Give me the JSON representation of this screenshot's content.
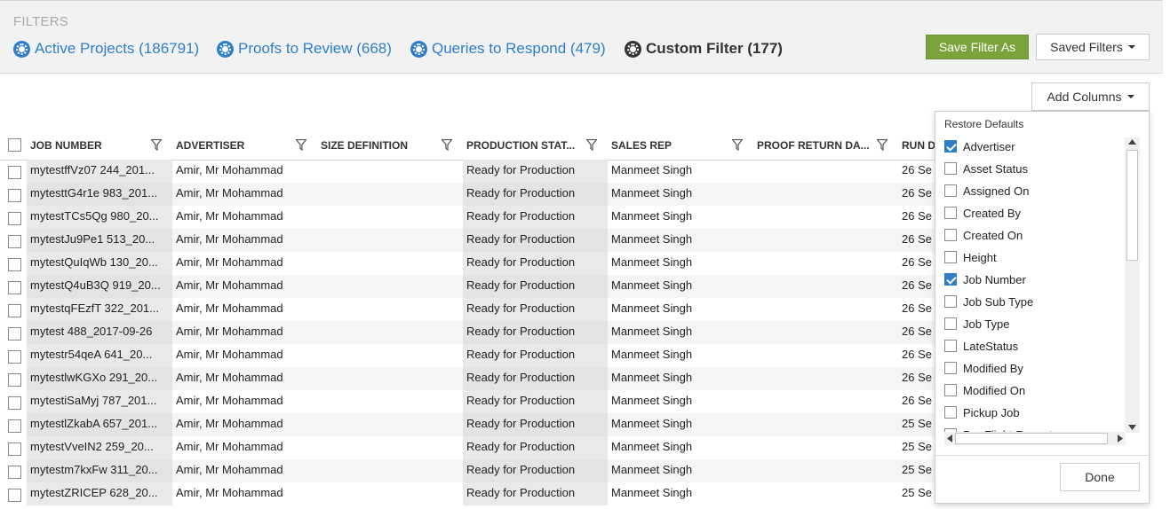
{
  "filters": {
    "title": "FILTERS",
    "links": [
      {
        "label": "Active Projects (186791)"
      },
      {
        "label": "Proofs to Review (668)"
      },
      {
        "label": "Queries to Respond (479)"
      },
      {
        "label": "Custom Filter (177)"
      }
    ],
    "save_filter_label": "Save Filter As",
    "saved_filters_label": "Saved Filters"
  },
  "add_columns_label": "Add Columns",
  "table": {
    "headers": [
      "JOB NUMBER",
      "ADVERTISER",
      "SIZE DEFINITION",
      "PRODUCTION STAT...",
      "SALES REP",
      "PROOF RETURN DA...",
      "RUN D"
    ],
    "rows": [
      {
        "job": "mytestffVz07 244_201...",
        "advertiser": "Amir, Mr Mohammad",
        "size": "",
        "status": "Ready for Production",
        "rep": "Manmeet Singh",
        "proof": "",
        "run": "26 Se"
      },
      {
        "job": "mytesttG4r1e 983_201...",
        "advertiser": "Amir, Mr Mohammad",
        "size": "",
        "status": "Ready for Production",
        "rep": "Manmeet Singh",
        "proof": "",
        "run": "26 Se"
      },
      {
        "job": "mytestTCs5Qg 980_20...",
        "advertiser": "Amir, Mr Mohammad",
        "size": "",
        "status": "Ready for Production",
        "rep": "Manmeet Singh",
        "proof": "",
        "run": "26 Se"
      },
      {
        "job": "mytestJu9Pe1 513_20...",
        "advertiser": "Amir, Mr Mohammad",
        "size": "",
        "status": "Ready for Production",
        "rep": "Manmeet Singh",
        "proof": "",
        "run": "26 Se"
      },
      {
        "job": "mytestQuIqWb 130_20...",
        "advertiser": "Amir, Mr Mohammad",
        "size": "",
        "status": "Ready for Production",
        "rep": "Manmeet Singh",
        "proof": "",
        "run": "26 Se"
      },
      {
        "job": "mytestQ4uB3Q 919_20...",
        "advertiser": "Amir, Mr Mohammad",
        "size": "",
        "status": "Ready for Production",
        "rep": "Manmeet Singh",
        "proof": "",
        "run": "26 Se"
      },
      {
        "job": "mytestqFEzfT 322_201...",
        "advertiser": "Amir, Mr Mohammad",
        "size": "",
        "status": "Ready for Production",
        "rep": "Manmeet Singh",
        "proof": "",
        "run": "26 Se"
      },
      {
        "job": "mytest 488_2017-09-26",
        "advertiser": "Amir, Mr Mohammad",
        "size": "",
        "status": "Ready for Production",
        "rep": "Manmeet Singh",
        "proof": "",
        "run": "26 Se"
      },
      {
        "job": "mytestr54qeA 641_20...",
        "advertiser": "Amir, Mr Mohammad",
        "size": "",
        "status": "Ready for Production",
        "rep": "Manmeet Singh",
        "proof": "",
        "run": "26 Se"
      },
      {
        "job": "mytestlwKGXo 291_20...",
        "advertiser": "Amir, Mr Mohammad",
        "size": "",
        "status": "Ready for Production",
        "rep": "Manmeet Singh",
        "proof": "",
        "run": "26 Se"
      },
      {
        "job": "mytestiSaMyj 787_201...",
        "advertiser": "Amir, Mr Mohammad",
        "size": "",
        "status": "Ready for Production",
        "rep": "Manmeet Singh",
        "proof": "",
        "run": "26 Se"
      },
      {
        "job": "mytestlZkabA 657_201...",
        "advertiser": "Amir, Mr Mohammad",
        "size": "",
        "status": "Ready for Production",
        "rep": "Manmeet Singh",
        "proof": "",
        "run": "25 Se"
      },
      {
        "job": "mytestVveIN2 259_20...",
        "advertiser": "Amir, Mr Mohammad",
        "size": "",
        "status": "Ready for Production",
        "rep": "Manmeet Singh",
        "proof": "",
        "run": "25 Se"
      },
      {
        "job": "mytestm7kxFw 311_20...",
        "advertiser": "Amir, Mr Mohammad",
        "size": "",
        "status": "Ready for Production",
        "rep": "Manmeet Singh",
        "proof": "",
        "run": "25 Se"
      },
      {
        "job": "mytestZRICEP 628_20...",
        "advertiser": "Amir, Mr Mohammad",
        "size": "",
        "status": "Ready for Production",
        "rep": "Manmeet Singh",
        "proof": "",
        "run": "25 Se"
      }
    ]
  },
  "columns_panel": {
    "restore_label": "Restore Defaults",
    "items": [
      {
        "label": "Advertiser",
        "checked": true
      },
      {
        "label": "Asset Status",
        "checked": false
      },
      {
        "label": "Assigned On",
        "checked": false
      },
      {
        "label": "Created By",
        "checked": false
      },
      {
        "label": "Created On",
        "checked": false
      },
      {
        "label": "Height",
        "checked": false
      },
      {
        "label": "Job Number",
        "checked": true
      },
      {
        "label": "Job Sub Type",
        "checked": false
      },
      {
        "label": "Job Type",
        "checked": false
      },
      {
        "label": "LateStatus",
        "checked": false
      },
      {
        "label": "Modified By",
        "checked": false
      },
      {
        "label": "Modified On",
        "checked": false
      },
      {
        "label": "Pickup Job",
        "checked": false
      },
      {
        "label": "Pre Flight Format",
        "checked": false
      }
    ],
    "done_label": "Done"
  },
  "colors": {
    "link_blue": "#2f7ec9",
    "save_green": "#7aa33b",
    "checked_blue": "#2f7ec9"
  },
  "icons": [
    "gear-icon",
    "filter-funnel-icon",
    "caret-down-icon",
    "checkbox-icon"
  ]
}
